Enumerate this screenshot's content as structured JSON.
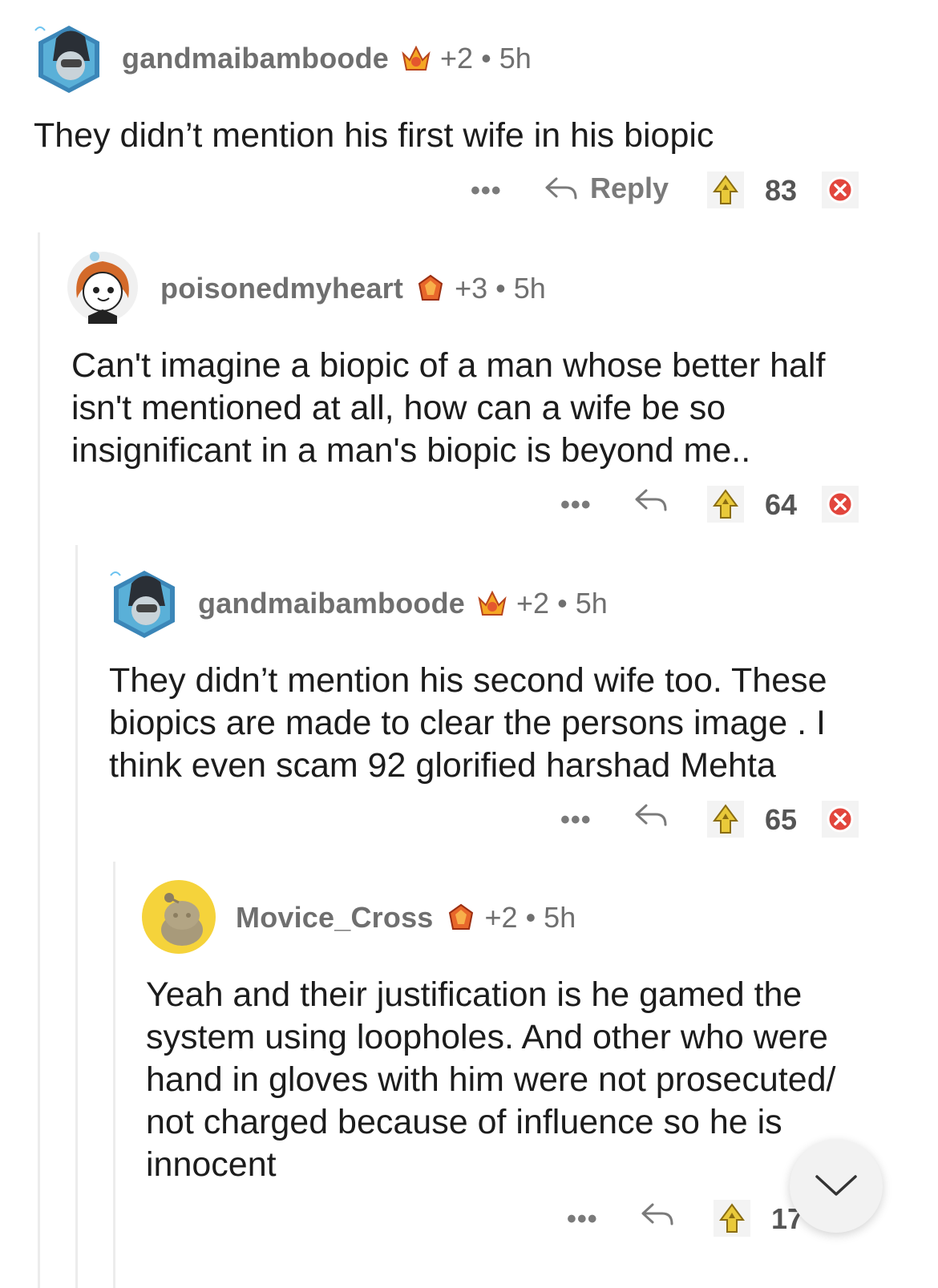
{
  "comments": [
    {
      "username": "gandmaibamboode",
      "karma": "+2",
      "age": "5h",
      "text": "They didn’t mention his first wife in his biopic",
      "more": "•••",
      "reply_label": "Reply",
      "score": "83"
    },
    {
      "username": "poisonedmyheart",
      "karma": "+3",
      "age": "5h",
      "text": "Can't imagine a biopic of a man whose better half isn't mentioned at all, how can a wife be so insignificant in a man's biopic is beyond me..",
      "more": "•••",
      "score": "64"
    },
    {
      "username": "gandmaibamboode",
      "karma": "+2",
      "age": "5h",
      "text": "They didn’t mention his second wife too. These biopics are made to clear the persons image . I think even scam 92 glorified harshad Mehta",
      "more": "•••",
      "score": "65"
    },
    {
      "username": "Movice_Cross",
      "karma": "+2",
      "age": "5h",
      "text": "Yeah and their justification is he gamed the system using loopholes. And other who were hand in gloves with him were not prosecuted/ not charged because of influence so he is innocent",
      "more": "•••",
      "score": "17"
    }
  ],
  "separator": "•",
  "colors": {
    "meta": "#6f6f6f",
    "upvote_award": "#e9c93a",
    "downvote": "#e2463d",
    "thread_line": "#ececec"
  },
  "icons": {
    "award": "crown-award-icon",
    "reply": "reply-arrow-icon",
    "upvote": "upvote-arrow-icon",
    "downvote": "downvote-x-icon",
    "scroll": "chevron-down-icon"
  }
}
